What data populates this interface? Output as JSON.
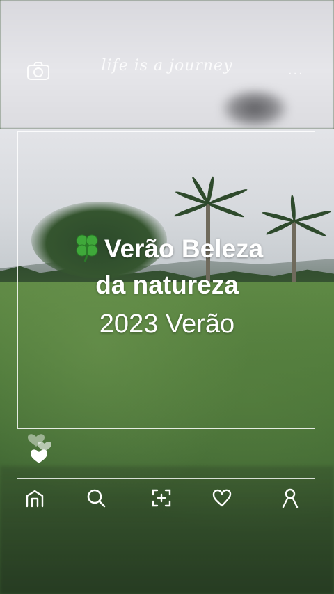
{
  "header": {
    "tagline": "life is a journey",
    "camera_icon": "camera-icon",
    "more_icon": "more-icon",
    "more_glyph": "..."
  },
  "caption": {
    "emoji_icon": "four-leaf-clover-icon",
    "line1": "Verão Beleza",
    "line2": "da natureza",
    "line3": "2023 Verão"
  },
  "reactions": {
    "icon": "hearts-icon"
  },
  "bottom_nav": {
    "items": [
      {
        "icon": "home-icon"
      },
      {
        "icon": "search-icon"
      },
      {
        "icon": "add-icon"
      },
      {
        "icon": "heart-icon"
      },
      {
        "icon": "profile-icon"
      }
    ]
  },
  "colors": {
    "overlay_white": "#ffffff",
    "grass": "#4f7a3b",
    "sky": "#e3e4e8",
    "clover": "#3fa83a"
  }
}
